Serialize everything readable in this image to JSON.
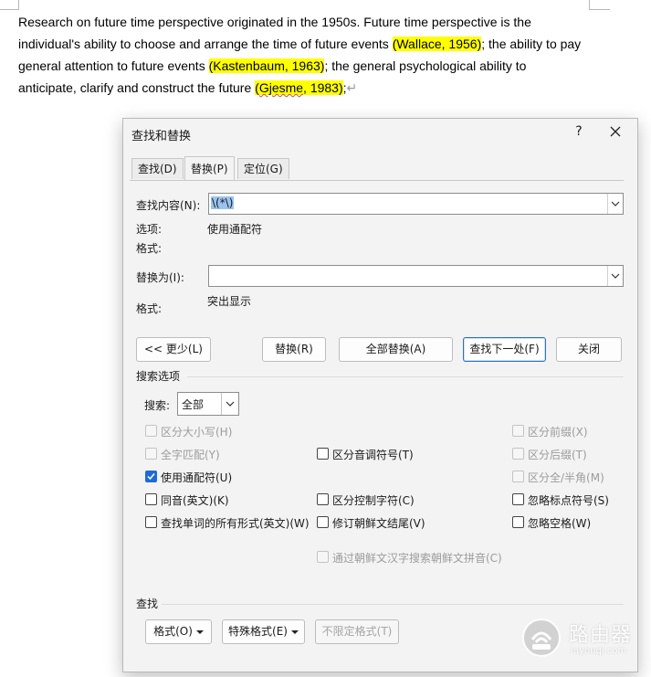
{
  "document": {
    "lines": [
      [
        {
          "t": "Research on future time perspective originated in the 1950s. Future time perspective is the",
          "hl": false
        }
      ],
      [
        {
          "t": "individual's ability to choose and arrange the time of future events ",
          "hl": false
        },
        {
          "t": "(Wallace, 1956)",
          "hl": true
        },
        {
          "t": "; the ability to pay",
          "hl": false
        }
      ],
      [
        {
          "t": "general attention to future events ",
          "hl": false
        },
        {
          "t": "(Kastenbaum, 1963)",
          "hl": true
        },
        {
          "t": "; the general psychological ability to",
          "hl": false
        }
      ],
      [
        {
          "t": "anticipate, clarify and construct the future ",
          "hl": false
        },
        {
          "t": "(",
          "hl": true
        },
        {
          "t": "Gjesme",
          "hl": true,
          "squiggle": true
        },
        {
          "t": ", 1983)",
          "hl": true
        },
        {
          "t": ";",
          "hl": false
        }
      ]
    ],
    "paragraph_mark": "↵"
  },
  "dialog": {
    "title": "查找和替换",
    "help": "?",
    "tabs": [
      "查找(D)",
      "替换(P)",
      "定位(G)"
    ],
    "active_tab": 1,
    "find": {
      "label": "查找内容(N):",
      "value": "\\(*\\)"
    },
    "options_label": "选项:",
    "options_value": "使用通配符",
    "format_label_1": "格式:",
    "replace": {
      "label": "替换为(I):",
      "value": ""
    },
    "format_label_2": "格式:",
    "format_value_2": "突出显示",
    "buttons": {
      "less": "<< 更少(L)",
      "replace": "替换(R)",
      "replace_all": "全部替换(A)",
      "find_next": "查找下一处(F)",
      "close": "关闭"
    },
    "search_options_title": "搜索选项",
    "search_label": "搜索:",
    "search_value": "全部",
    "checkboxes": {
      "match_case": {
        "label": "区分大小写(H)",
        "checked": false,
        "disabled": true
      },
      "whole_word": {
        "label": "全字匹配(Y)",
        "checked": false,
        "disabled": true
      },
      "wildcards": {
        "label": "使用通配符(U)",
        "checked": true,
        "disabled": false
      },
      "sounds_like": {
        "label": "同音(英文)(K)",
        "checked": false,
        "disabled": false
      },
      "all_forms": {
        "label": "查找单词的所有形式(英文)(W)",
        "checked": false,
        "disabled": false
      },
      "diacritics": {
        "label": "区分音调符号(T)",
        "checked": false,
        "disabled": false
      },
      "control_chars": {
        "label": "区分控制字符(C)",
        "checked": false,
        "disabled": false
      },
      "korean_endings": {
        "label": "修订朝鲜文结尾(V)",
        "checked": false,
        "disabled": false
      },
      "korean_hanja": {
        "label": "通过朝鲜文汉字搜索朝鲜文拼音(C)",
        "checked": false,
        "disabled": true
      },
      "prefix": {
        "label": "区分前缀(X)",
        "checked": false,
        "disabled": true
      },
      "suffix": {
        "label": "区分后缀(T)",
        "checked": false,
        "disabled": true
      },
      "full_half": {
        "label": "区分全/半角(M)",
        "checked": false,
        "disabled": true
      },
      "ignore_punct": {
        "label": "忽略标点符号(S)",
        "checked": false,
        "disabled": false
      },
      "ignore_space": {
        "label": "忽略空格(W)",
        "checked": false,
        "disabled": false
      }
    },
    "find_section_title": "查找",
    "bottom_buttons": {
      "format": "格式(O)",
      "special": "特殊格式(E)",
      "no_format": "不限定格式(T)"
    }
  },
  "watermark": {
    "name": "路由器",
    "url": "luyouqi.com"
  },
  "colors": {
    "highlight": "#ffff00",
    "accent": "#1f6cd1"
  }
}
